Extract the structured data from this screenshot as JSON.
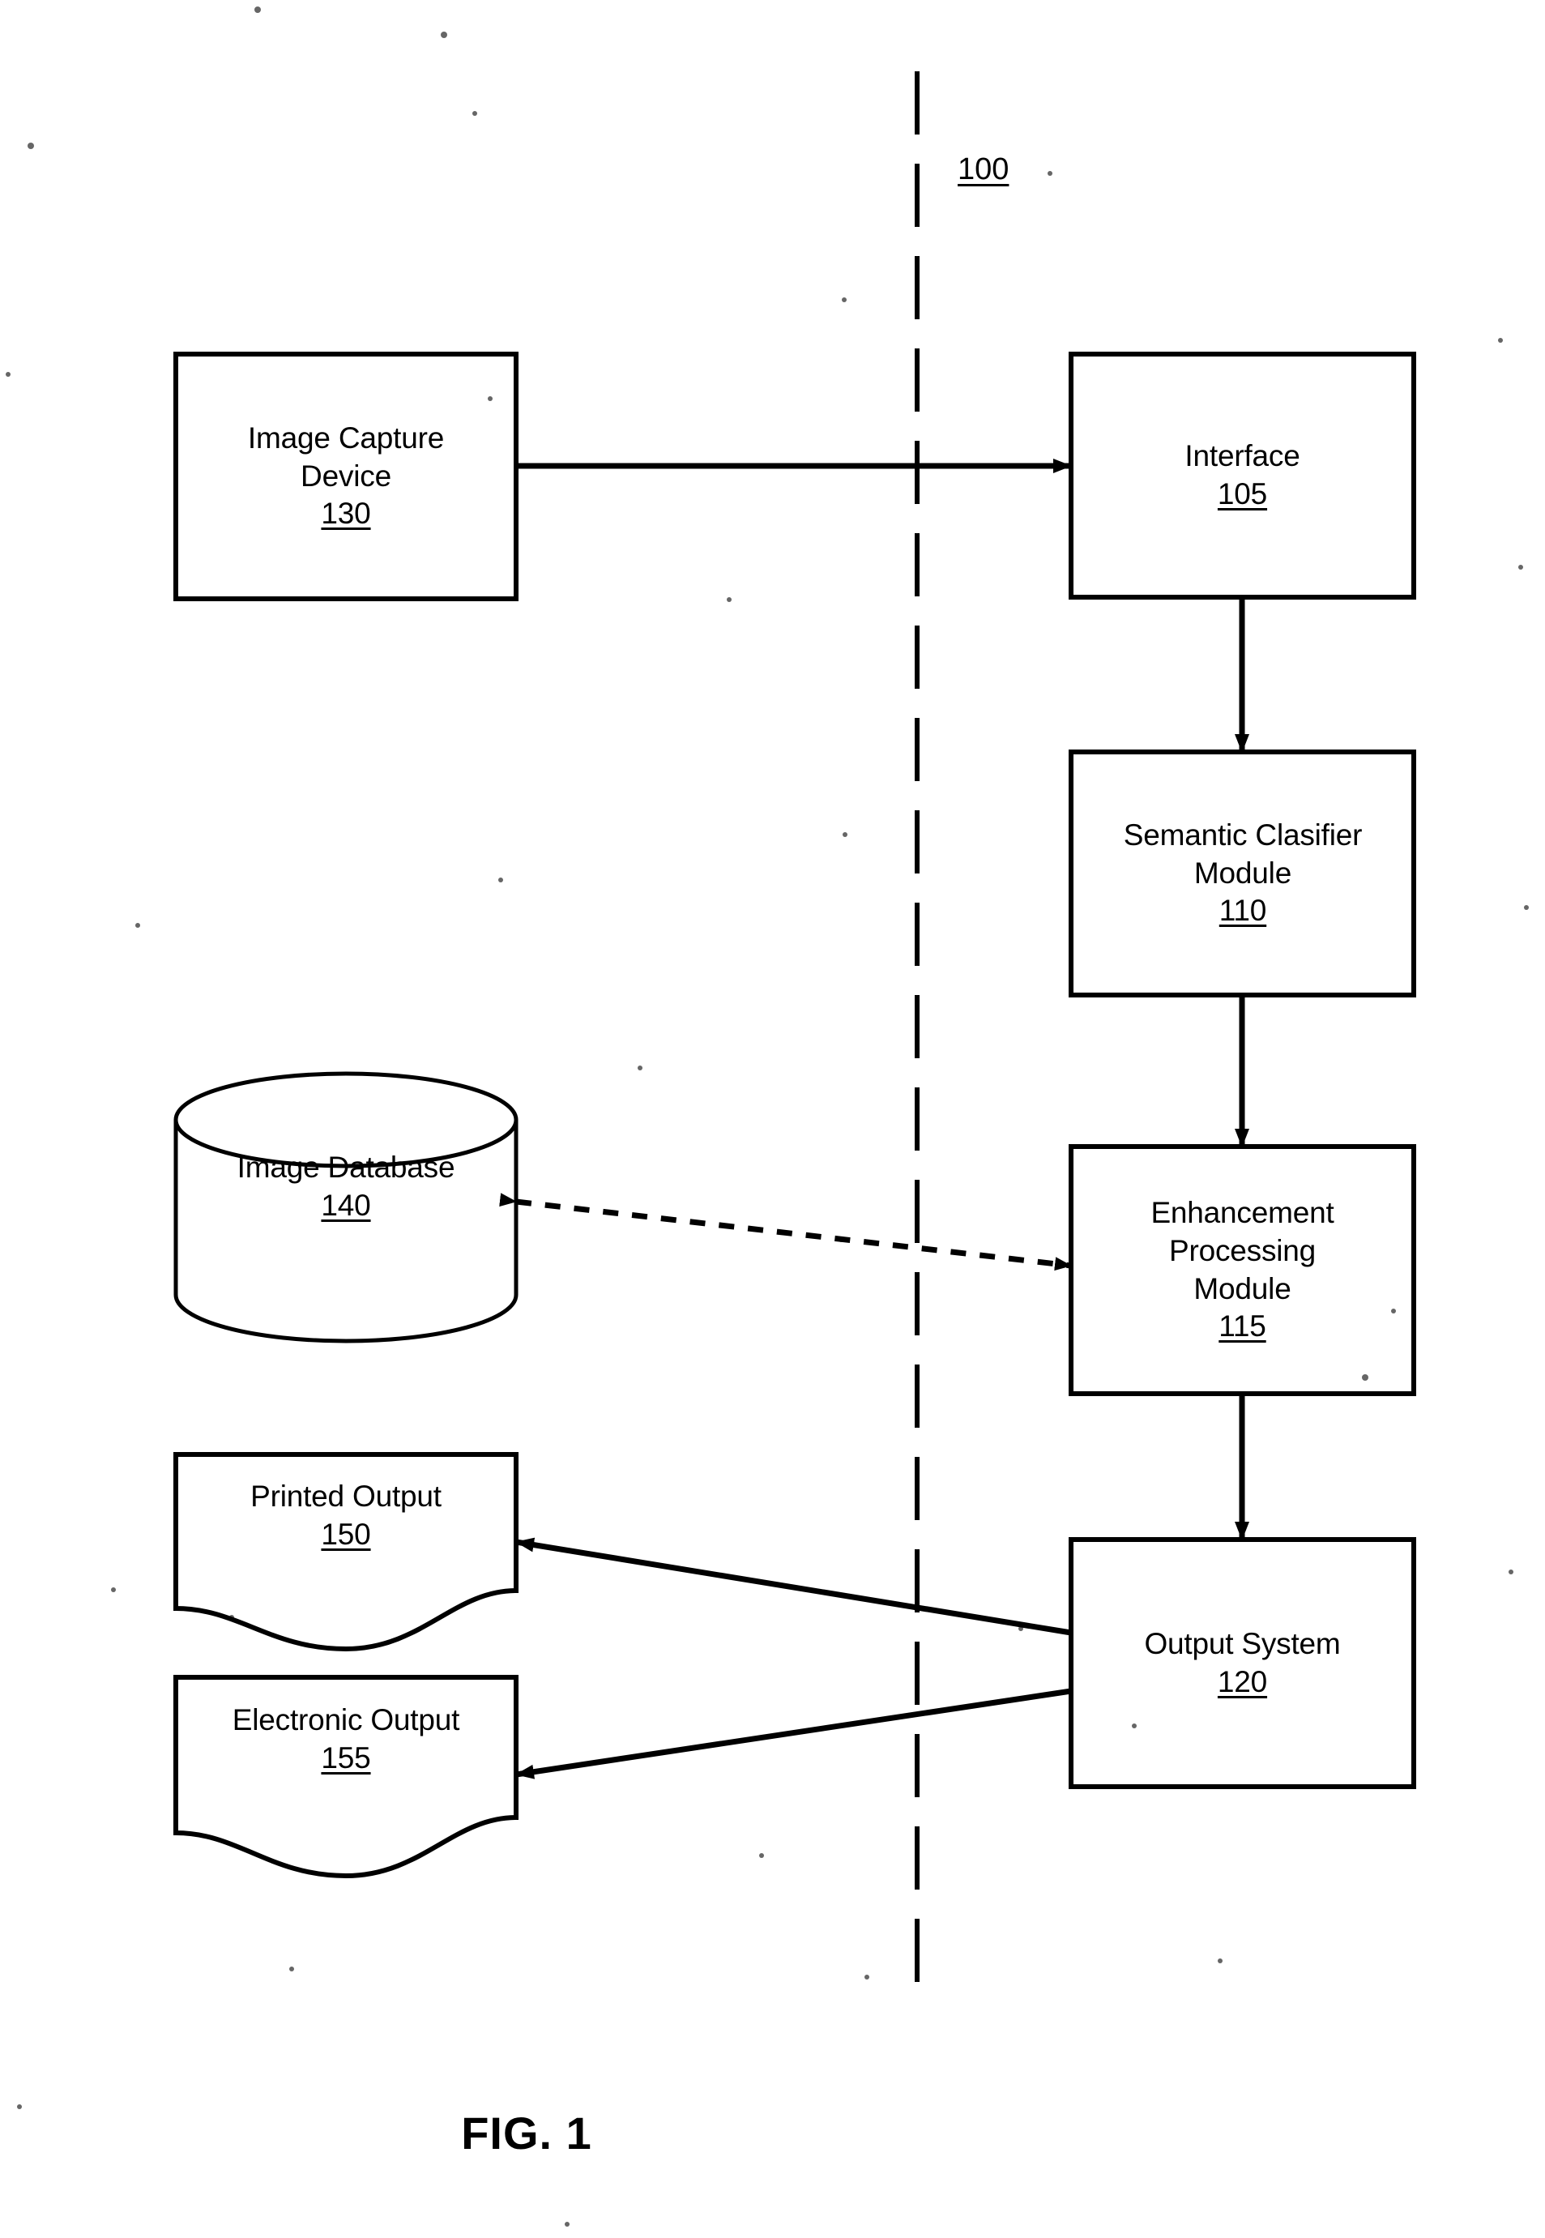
{
  "figure": {
    "caption": "FIG. 1",
    "system_ref": "100",
    "type": "block-diagram",
    "ink_color": "#000000",
    "background_color": "#ffffff",
    "divider": {
      "style": "dashed-vertical",
      "meaning": "system boundary"
    }
  },
  "nodes": [
    {
      "id": "image-capture-device",
      "title": "Image Capture",
      "title2": "Device",
      "ref": "130",
      "shape": "rectangle",
      "side": "left"
    },
    {
      "id": "interface",
      "title": "Interface",
      "title2": "",
      "ref": "105",
      "shape": "rectangle",
      "side": "right"
    },
    {
      "id": "semantic-clasifier-module",
      "title": "Semantic Clasifier",
      "title2": "Module",
      "ref": "110",
      "shape": "rectangle",
      "side": "right"
    },
    {
      "id": "enhancement-processing-module",
      "title": "Enhancement",
      "title2": "Processing",
      "title3": "Module",
      "ref": "115",
      "shape": "rectangle",
      "side": "right"
    },
    {
      "id": "image-database",
      "title": "Image Database",
      "title2": "",
      "ref": "140",
      "shape": "cylinder",
      "side": "left"
    },
    {
      "id": "printed-output",
      "title": "Printed Output",
      "title2": "",
      "ref": "150",
      "shape": "document",
      "side": "left"
    },
    {
      "id": "electronic-output",
      "title": "Electronic Output",
      "title2": "",
      "ref": "155",
      "shape": "document",
      "side": "left"
    },
    {
      "id": "output-system",
      "title": "Output System",
      "title2": "",
      "ref": "120",
      "shape": "rectangle",
      "side": "right"
    }
  ],
  "edges": [
    {
      "from": "image-capture-device",
      "to": "interface",
      "style": "solid",
      "arrows": "single"
    },
    {
      "from": "interface",
      "to": "semantic-clasifier-module",
      "style": "solid",
      "arrows": "single"
    },
    {
      "from": "semantic-clasifier-module",
      "to": "enhancement-processing-module",
      "style": "solid",
      "arrows": "single"
    },
    {
      "from": "enhancement-processing-module",
      "to": "image-database",
      "style": "dashed",
      "arrows": "double"
    },
    {
      "from": "enhancement-processing-module",
      "to": "output-system",
      "style": "solid",
      "arrows": "single"
    },
    {
      "from": "output-system",
      "to": "printed-output",
      "style": "solid",
      "arrows": "single"
    },
    {
      "from": "output-system",
      "to": "electronic-output",
      "style": "solid",
      "arrows": "single"
    }
  ]
}
